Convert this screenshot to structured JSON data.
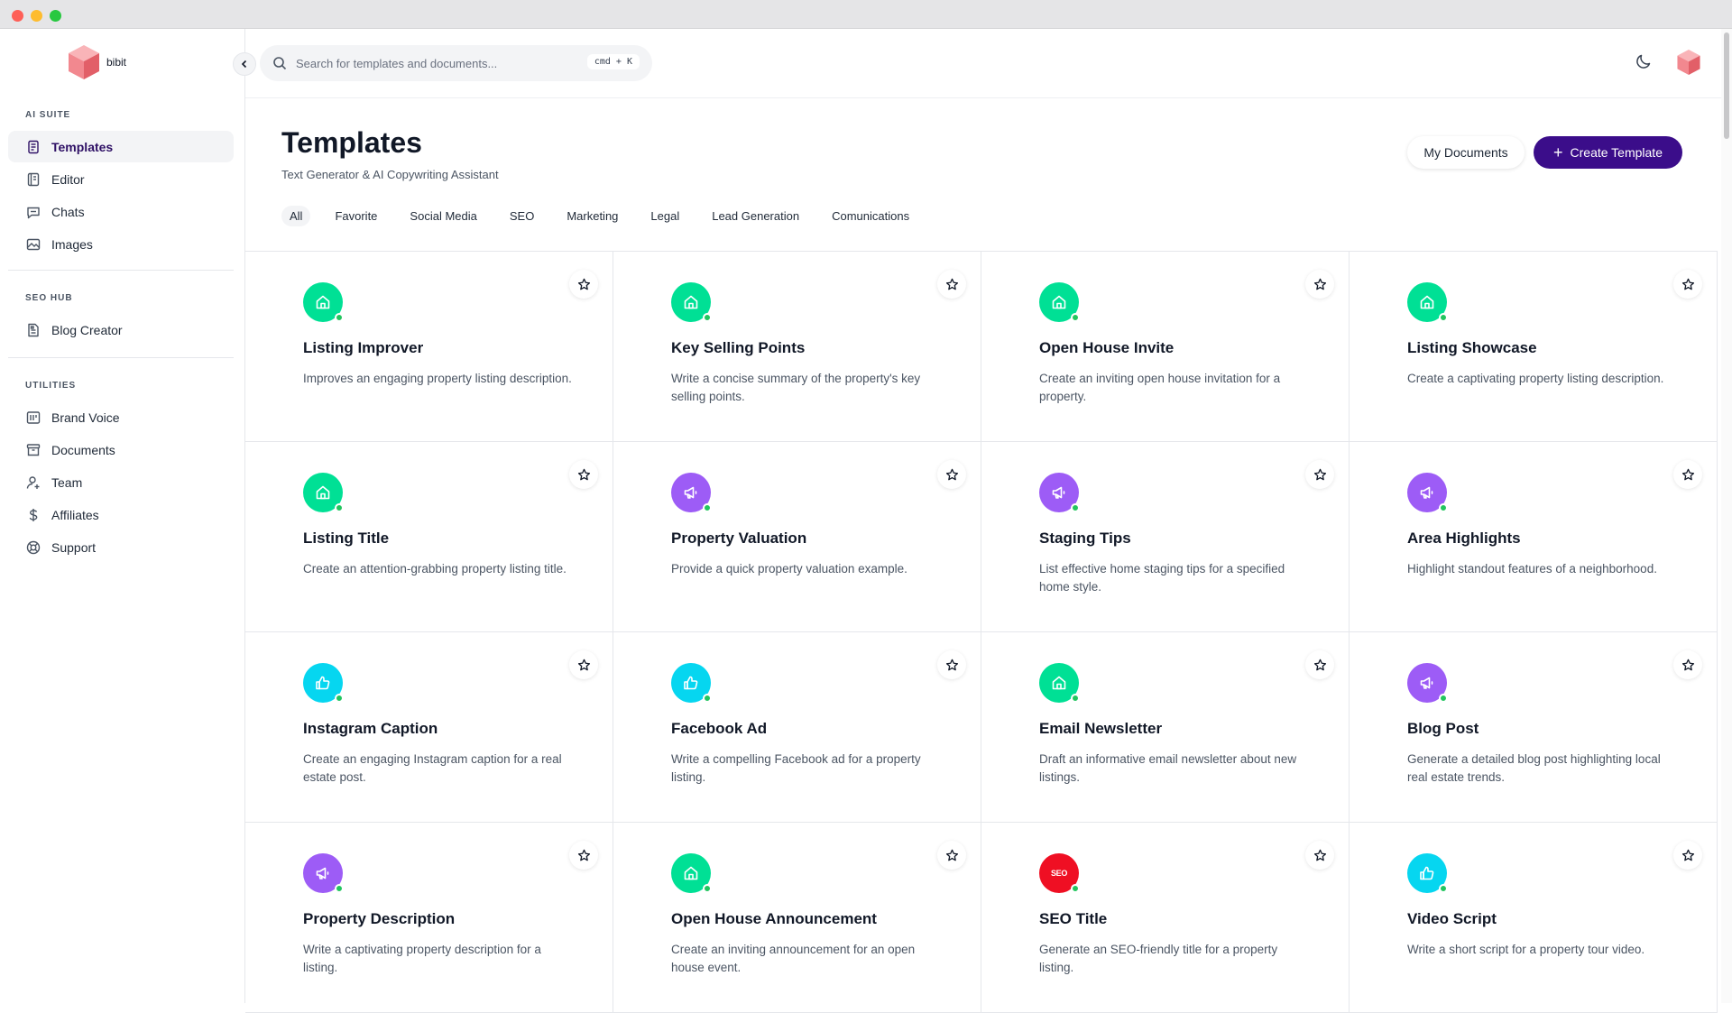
{
  "app": {
    "name": "bibit"
  },
  "search": {
    "placeholder": "Search for templates and documents...",
    "shortcut": "cmd + K"
  },
  "sidebar": {
    "sections": [
      {
        "title": "AI SUITE",
        "items": [
          {
            "label": "Templates",
            "icon": "document-icon",
            "active": true
          },
          {
            "label": "Editor",
            "icon": "editor-icon"
          },
          {
            "label": "Chats",
            "icon": "chat-icon"
          },
          {
            "label": "Images",
            "icon": "image-icon"
          }
        ]
      },
      {
        "title": "SEO HUB",
        "items": [
          {
            "label": "Blog Creator",
            "icon": "blog-icon"
          }
        ]
      },
      {
        "title": "UTILITIES",
        "items": [
          {
            "label": "Brand Voice",
            "icon": "brand-voice-icon"
          },
          {
            "label": "Documents",
            "icon": "archive-icon"
          },
          {
            "label": "Team",
            "icon": "user-icon"
          },
          {
            "label": "Affiliates",
            "icon": "dollar-icon"
          },
          {
            "label": "Support",
            "icon": "lifebuoy-icon"
          }
        ]
      }
    ]
  },
  "header": {
    "title": "Templates",
    "subtitle": "Text Generator & AI Copywriting Assistant",
    "my_documents_label": "My Documents",
    "create_template_label": "Create Template"
  },
  "filters": [
    "All",
    "Favorite",
    "Social Media",
    "SEO",
    "Marketing",
    "Legal",
    "Lead Generation",
    "Comunications"
  ],
  "colors": {
    "green": "#00e095",
    "purple": "#9d5cf6",
    "cyan": "#06d6f0",
    "red": "#ef0f23",
    "brand": "#3b0d8a"
  },
  "templates": [
    {
      "title": "Listing Improver",
      "desc": "Improves an engaging property listing description.",
      "icon": "home-icon",
      "color": "green"
    },
    {
      "title": "Key Selling Points",
      "desc": "Write a concise summary of the property's key selling points.",
      "icon": "home-icon",
      "color": "green"
    },
    {
      "title": "Open House Invite",
      "desc": "Create an inviting open house invitation for a property.",
      "icon": "home-icon",
      "color": "green"
    },
    {
      "title": "Listing Showcase",
      "desc": "Create a captivating property listing description.",
      "icon": "home-icon",
      "color": "green"
    },
    {
      "title": "Listing Title",
      "desc": "Create an attention-grabbing property listing title.",
      "icon": "home-icon",
      "color": "green"
    },
    {
      "title": "Property Valuation",
      "desc": "Provide a quick property valuation example.",
      "icon": "megaphone-icon",
      "color": "purple"
    },
    {
      "title": "Staging Tips",
      "desc": "List effective home staging tips for a specified home style.",
      "icon": "megaphone-icon",
      "color": "purple"
    },
    {
      "title": "Area Highlights",
      "desc": "Highlight standout features of a neighborhood.",
      "icon": "megaphone-icon",
      "color": "purple"
    },
    {
      "title": "Instagram Caption",
      "desc": "Create an engaging Instagram caption for a real estate post.",
      "icon": "thumbs-up-icon",
      "color": "cyan"
    },
    {
      "title": "Facebook Ad",
      "desc": "Write a compelling Facebook ad for a property listing.",
      "icon": "thumbs-up-icon",
      "color": "cyan"
    },
    {
      "title": "Email Newsletter",
      "desc": "Draft an informative email newsletter about new listings.",
      "icon": "home-icon",
      "color": "green"
    },
    {
      "title": "Blog Post",
      "desc": "Generate a detailed blog post highlighting local real estate trends.",
      "icon": "megaphone-icon",
      "color": "purple"
    },
    {
      "title": "Property Description",
      "desc": "Write a captivating property description for a listing.",
      "icon": "megaphone-icon",
      "color": "purple"
    },
    {
      "title": "Open House Announcement",
      "desc": "Create an inviting announcement for an open house event.",
      "icon": "home-icon",
      "color": "green"
    },
    {
      "title": "SEO Title",
      "desc": "Generate an SEO-friendly title for a property listing.",
      "icon": "seo-icon",
      "icon_text": "SEO",
      "color": "red"
    },
    {
      "title": "Video Script",
      "desc": "Write a short script for a property tour video.",
      "icon": "thumbs-up-icon",
      "color": "cyan"
    }
  ]
}
